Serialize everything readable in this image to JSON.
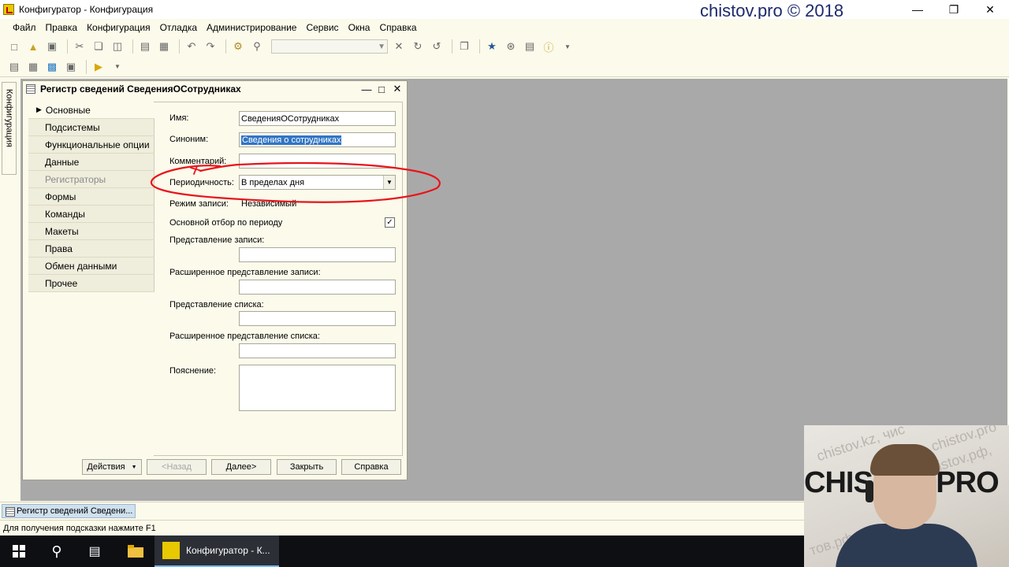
{
  "window": {
    "title": "Конфигуратор - Конфигурация",
    "watermark": "chistov.pro © 2018"
  },
  "menu": [
    "Файл",
    "Правка",
    "Конфигурация",
    "Отладка",
    "Администрирование",
    "Сервис",
    "Окна",
    "Справка"
  ],
  "left_tab": "Конфигурация",
  "dialog": {
    "title": "Регистр сведений СведенияОСотрудниках",
    "nav": [
      {
        "label": "Основные",
        "active": true
      },
      {
        "label": "Подсистемы"
      },
      {
        "label": "Функциональные опции"
      },
      {
        "label": "Данные"
      },
      {
        "label": "Регистраторы",
        "disabled": true
      },
      {
        "label": "Формы"
      },
      {
        "label": "Команды"
      },
      {
        "label": "Макеты"
      },
      {
        "label": "Права"
      },
      {
        "label": "Обмен данными"
      },
      {
        "label": "Прочее"
      }
    ],
    "fields": {
      "name_label": "Имя:",
      "name_value": "СведенияОСотрудниках",
      "synonym_label": "Синоним:",
      "synonym_value": "Сведения о сотрудниках",
      "comment_label": "Комментарий:",
      "comment_value": "",
      "periodicity_label": "Периодичность:",
      "periodicity_value": "В пределах дня",
      "write_mode_label": "Режим записи:",
      "write_mode_value": "Независимый",
      "main_filter_label": "Основной отбор по периоду",
      "main_filter_checked": true,
      "record_presentation_label": "Представление записи:",
      "ext_record_presentation_label": "Расширенное представление записи:",
      "list_presentation_label": "Представление списка:",
      "ext_list_presentation_label": "Расширенное представление списка:",
      "explanation_label": "Пояснение:"
    },
    "buttons": {
      "actions": "Действия",
      "back": "<Назад",
      "next": "Далее>",
      "close": "Закрыть",
      "help": "Справка"
    },
    "annotation_color": "#e8141b"
  },
  "window_tab": "Регистр сведений Сведени...",
  "status": "Для получения подсказки нажмите F1",
  "taskbar": {
    "app_label": "Конфигуратор - К..."
  },
  "webcam": {
    "bg_texts": [
      "chistov.kz, чис",
      "chistov.pro",
      "chistov.рф,",
      "тов.рф."
    ],
    "big_text": "CHISTOV.PRO"
  }
}
